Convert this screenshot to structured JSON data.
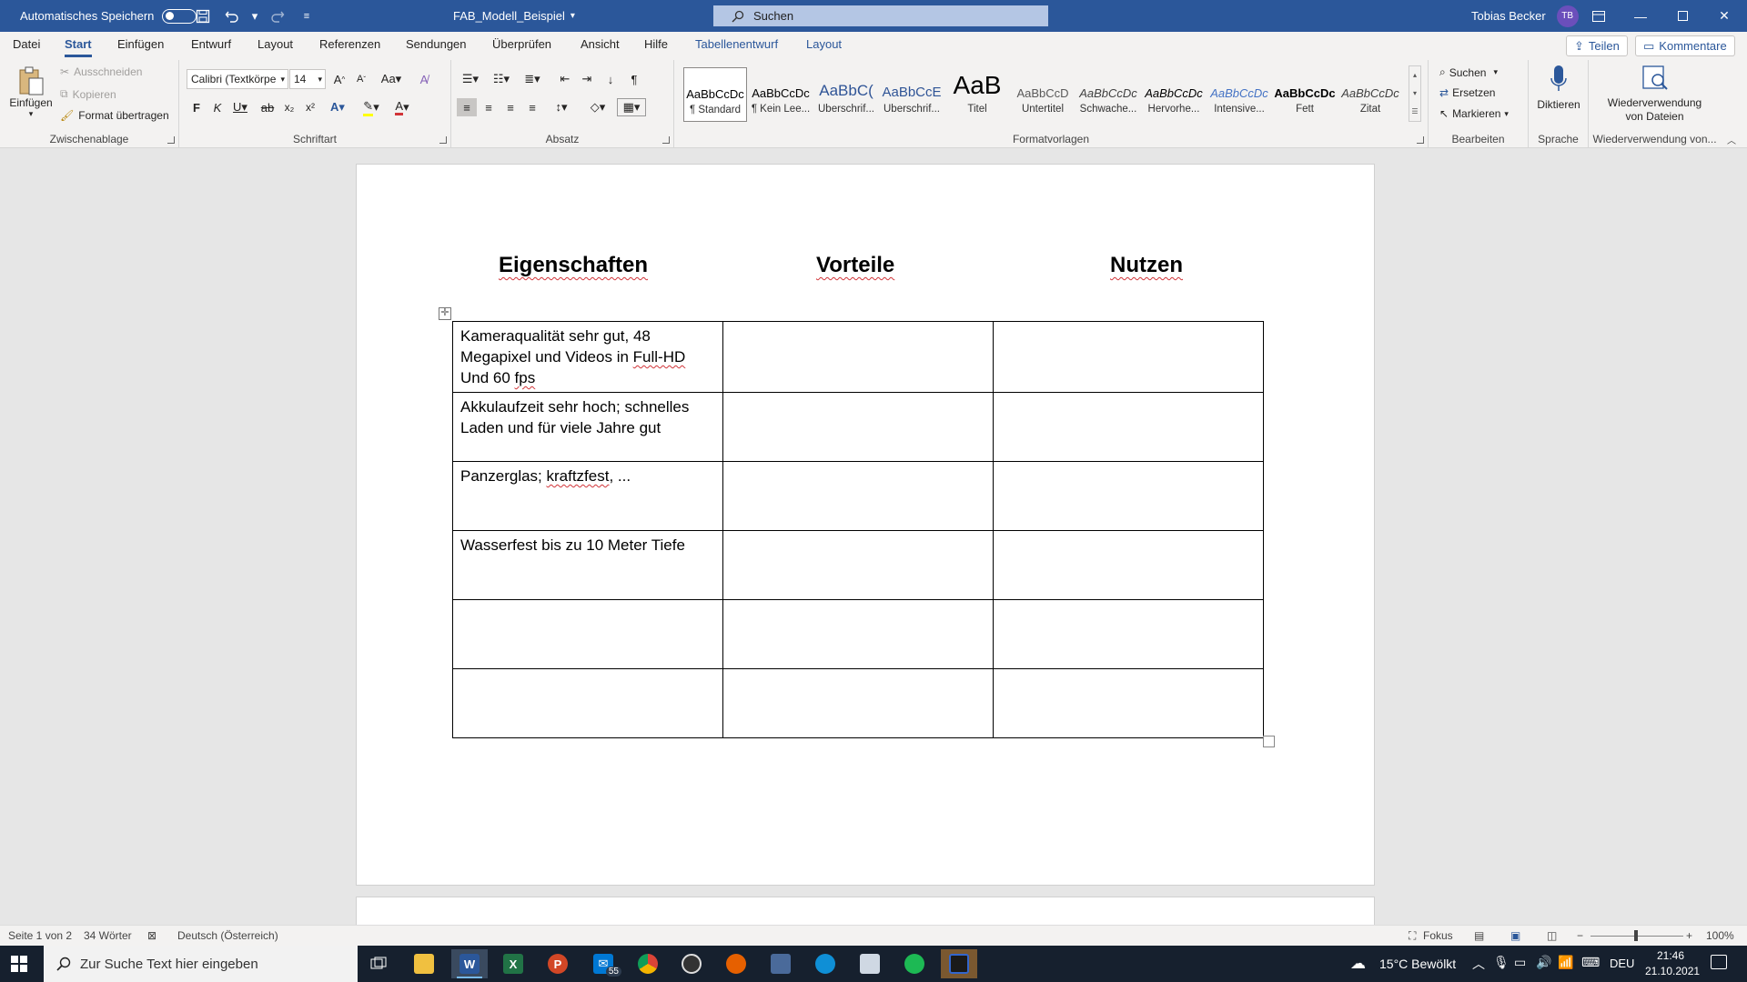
{
  "titlebar": {
    "autosave_label": "Automatisches Speichern",
    "doc_title": "FAB_Modell_Beispiel",
    "search_placeholder": "Suchen",
    "user_name": "Tobias Becker",
    "user_initials": "TB"
  },
  "tabs": {
    "datei": "Datei",
    "start": "Start",
    "einfuegen": "Einfügen",
    "entwurf": "Entwurf",
    "layout": "Layout",
    "referenzen": "Referenzen",
    "sendungen": "Sendungen",
    "ueberpruefen": "Überprüfen",
    "ansicht": "Ansicht",
    "hilfe": "Hilfe",
    "tabellenentwurf": "Tabellenentwurf",
    "layout2": "Layout"
  },
  "share": {
    "teilen": "Teilen",
    "kommentare": "Kommentare"
  },
  "ribbon": {
    "clipboard": {
      "paste": "Einfügen",
      "cut": "Ausschneiden",
      "copy": "Kopieren",
      "format_painter": "Format übertragen",
      "label": "Zwischenablage"
    },
    "font": {
      "name": "Calibri (Textkörpe",
      "size": "14",
      "label": "Schriftart"
    },
    "paragraph": {
      "label": "Absatz"
    },
    "styles": {
      "label": "Formatvorlagen",
      "items": [
        {
          "preview": "AaBbCcDc",
          "name": "¶ Standard"
        },
        {
          "preview": "AaBbCcDc",
          "name": "¶ Kein Lee..."
        },
        {
          "preview": "AaBbC(",
          "name": "Überschrif..."
        },
        {
          "preview": "AaBbCcE",
          "name": "Überschrif..."
        },
        {
          "preview": "AaB",
          "name": "Titel"
        },
        {
          "preview": "AaBbCcD",
          "name": "Untertitel"
        },
        {
          "preview": "AaBbCcDc",
          "name": "Schwache..."
        },
        {
          "preview": "AaBbCcDc",
          "name": "Hervorhe..."
        },
        {
          "preview": "AaBbCcDc",
          "name": "Intensive..."
        },
        {
          "preview": "AaBbCcDc",
          "name": "Fett"
        },
        {
          "preview": "AaBbCcDc",
          "name": "Zitat"
        }
      ]
    },
    "edit": {
      "search": "Suchen",
      "replace": "Ersetzen",
      "select": "Markieren",
      "label": "Bearbeiten"
    },
    "voice": {
      "dictate": "Diktieren",
      "label": "Sprache"
    },
    "reuse": {
      "line1": "Wiederverwendung",
      "line2": "von Dateien",
      "label": "Wiederverwendung von..."
    }
  },
  "document": {
    "headers": {
      "eigenschaften": "Eigenschaften",
      "vorteile": "Vorteile",
      "nutzen": "Nutzen"
    },
    "rows": [
      {
        "c1a": "Kameraqualität sehr gut, 48 Megapixel und Videos in ",
        "c1b": "Full-HD",
        "c1c": " Und 60 ",
        "c1d": "fps"
      },
      {
        "c1": "Akkulaufzeit sehr hoch; schnelles Laden und für viele Jahre gut"
      },
      {
        "c1a": "Panzerglas; ",
        "c1b": "kraftzfest",
        "c1c": ", ..."
      },
      {
        "c1": "Wasserfest bis zu 10 Meter Tiefe"
      }
    ]
  },
  "status": {
    "page": "Seite 1 von 2",
    "words": "34 Wörter",
    "language": "Deutsch (Österreich)",
    "focus": "Fokus",
    "zoom": "100%"
  },
  "taskbar": {
    "search_placeholder": "Zur Suche Text hier eingeben",
    "mail_badge": "55",
    "weather": "15°C  Bewölkt",
    "lang": "DEU",
    "time": "21:46",
    "date": "21.10.2021"
  },
  "colors": {
    "word_blue": "#2b579a",
    "taskbar": "#16202e"
  }
}
